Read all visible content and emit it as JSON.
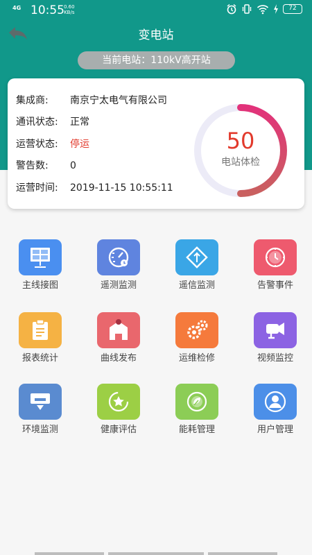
{
  "status_bar": {
    "network": "4G",
    "time": "10:55",
    "speed_value": "0.60",
    "speed_unit": "KB/s",
    "battery": "72"
  },
  "header": {
    "title": "变电站",
    "current_station": "当前电站：110kV高开站"
  },
  "info": {
    "integrator_label": "集成商:",
    "integrator_value": "南京宁太电气有限公司",
    "comm_label": "通讯状态:",
    "comm_value": "正常",
    "op_label": "运营状态:",
    "op_value": "停运",
    "alarm_count_label": "警告数:",
    "alarm_count_value": "0",
    "op_time_label": "运营时间:",
    "op_time_value": "2019-11-15 10:55:11"
  },
  "gauge": {
    "score": "50",
    "label": "电站体检",
    "fraction": 0.5
  },
  "menu": [
    {
      "label": "主线接图",
      "icon": "single-line-diagram-icon",
      "color": "#4a8ff0"
    },
    {
      "label": "遥测监测",
      "icon": "telemetry-gauge-icon",
      "color": "#5f84df"
    },
    {
      "label": "遥信监测",
      "icon": "telesignal-icon",
      "color": "#3aa6e6"
    },
    {
      "label": "告警事件",
      "icon": "alarm-clock-icon",
      "color": "#ee5a6e"
    },
    {
      "label": "报表统计",
      "icon": "report-clipboard-icon",
      "color": "#f5b244"
    },
    {
      "label": "曲线发布",
      "icon": "curve-release-icon",
      "color": "#e9676d"
    },
    {
      "label": "运维检修",
      "icon": "maintenance-gears-icon",
      "color": "#f57a3c"
    },
    {
      "label": "视频监控",
      "icon": "video-camera-icon",
      "color": "#8c63e3"
    },
    {
      "label": "环境监测",
      "icon": "environment-monitor-icon",
      "color": "#5a8bd0"
    },
    {
      "label": "健康评估",
      "icon": "health-star-icon",
      "color": "#9ccf45"
    },
    {
      "label": "能耗管理",
      "icon": "energy-leaf-icon",
      "color": "#8ccd56"
    },
    {
      "label": "用户管理",
      "icon": "user-icon",
      "color": "#4c8fe8"
    }
  ],
  "colors": {
    "header": "#11988a",
    "alarm_red": "#e23a2c",
    "gauge_start": "#e2327a",
    "gauge_end": "#c9605f"
  }
}
